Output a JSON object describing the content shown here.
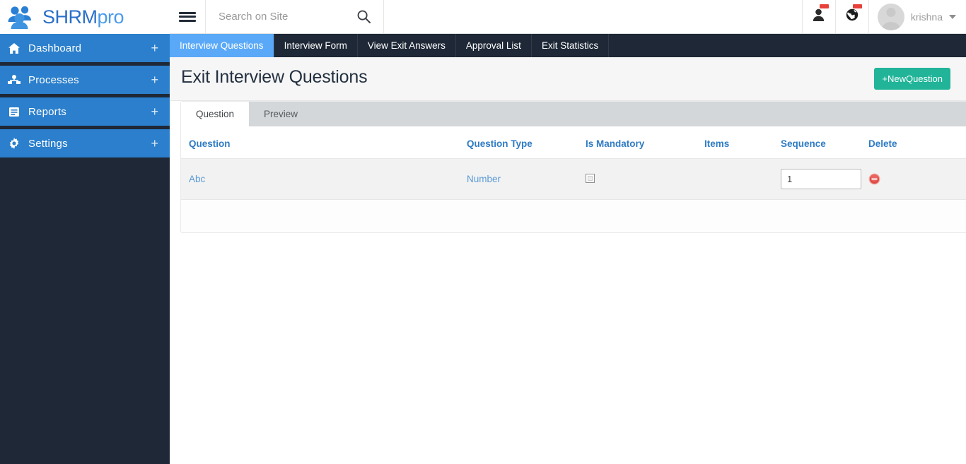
{
  "brand": {
    "name_main": "SHRM",
    "name_suffix": "pro",
    "logo_icon": "people-group-icon"
  },
  "sidebar": {
    "items": [
      {
        "label": "Dashboard",
        "icon": "home-icon",
        "plus": "+"
      },
      {
        "label": "Processes",
        "icon": "sitemap-icon",
        "plus": "+"
      },
      {
        "label": "Reports",
        "icon": "clipboard-icon",
        "plus": "+"
      },
      {
        "label": "Settings",
        "icon": "gear-icon",
        "plus": "+"
      }
    ]
  },
  "topbar": {
    "menu_icon": "hamburger-icon",
    "search": {
      "placeholder": "Search on Site",
      "value": "",
      "icon": "search-icon"
    },
    "icons": [
      {
        "name": "user-icon",
        "badge": ""
      },
      {
        "name": "globe-icon",
        "badge": ""
      }
    ],
    "user": {
      "name": "krishna",
      "avatar": "avatar-placeholder",
      "caret": "chevron-down-icon"
    }
  },
  "nav_tabs": {
    "active": "Interview Questions",
    "items": [
      {
        "label": "Interview Questions"
      },
      {
        "label": "Interview Form"
      },
      {
        "label": "View Exit Answers"
      },
      {
        "label": "Approval List"
      },
      {
        "label": "Exit Statistics"
      }
    ]
  },
  "page": {
    "title": "Exit Interview Questions",
    "new_button_label": "+NewQuestion"
  },
  "inner_tabs": {
    "active": "Question",
    "items": [
      {
        "label": "Question"
      },
      {
        "label": "Preview"
      }
    ]
  },
  "table": {
    "headers": [
      "Question",
      "Question Type",
      "Is Mandatory",
      "Items",
      "Sequence",
      "Delete"
    ],
    "rows": [
      {
        "question": "Abc",
        "question_type": "Number",
        "is_mandatory": false,
        "items": "",
        "sequence": "1",
        "delete_icon": "remove-circle-icon"
      }
    ]
  },
  "colors": {
    "sidebar_bg": "#1e2836",
    "sidebar_item": "#2b7fcc",
    "accent_blue": "#5aa9f8",
    "link_blue": "#2f7bc4",
    "green_button": "#21b499",
    "badge_red": "#e8413a",
    "delete_red": "#e04a46"
  }
}
